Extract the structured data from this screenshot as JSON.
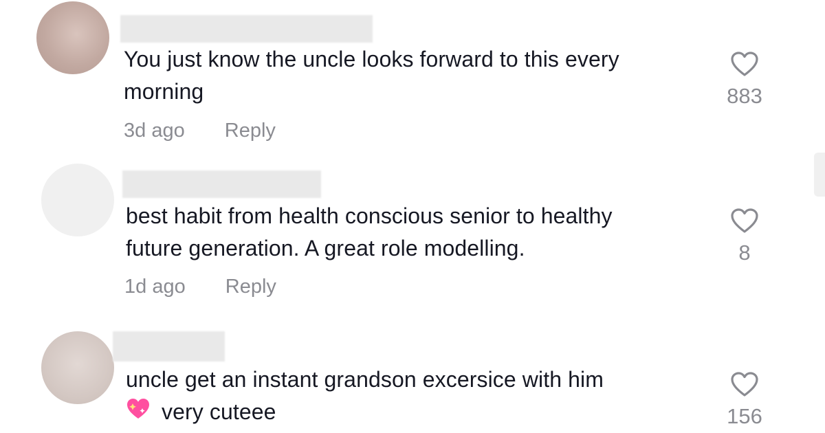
{
  "comments": [
    {
      "text_lines": [
        "You just know the uncle looks forward to this every",
        "morning"
      ],
      "time": "3d ago",
      "reply_label": "Reply",
      "likes": "883",
      "avatar_color": "#c9b2ab"
    },
    {
      "text_lines": [
        "best habit from health conscious senior to healthy",
        "future generation. A great role modelling."
      ],
      "time": "1d ago",
      "reply_label": "Reply",
      "likes": "8",
      "avatar_color": "#f0f0f0"
    },
    {
      "text_lines": [
        "uncle get an instant grandson excersice with him",
        "very cuteee"
      ],
      "emoji": "sparkling-heart-icon",
      "time": "",
      "reply_label": "",
      "likes": "156",
      "avatar_color": "#d6ccc8"
    }
  ],
  "colors": {
    "text": "#161823",
    "muted": "#8a8b91",
    "heart_outline": "#8a8b91",
    "emoji_heart": "#ff4fa0"
  }
}
